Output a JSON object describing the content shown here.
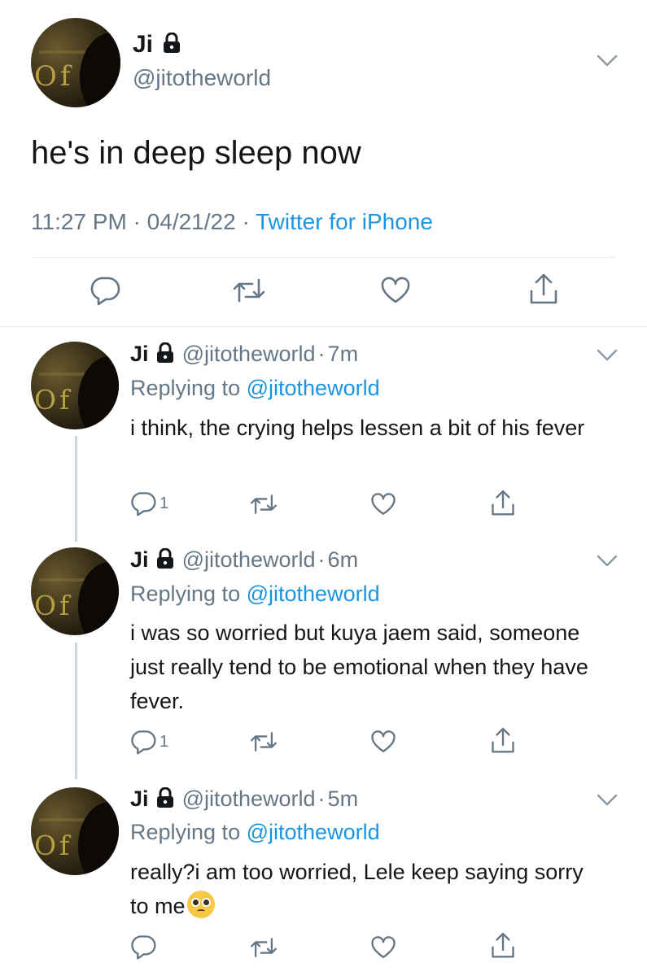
{
  "main_tweet": {
    "display_name": "Ji",
    "handle": "@jitotheworld",
    "text": "he's in deep sleep now",
    "time": "11:27 PM",
    "date": "04/21/22",
    "separator": "·",
    "source": "Twitter for iPhone"
  },
  "avatar_glyph": "Of",
  "replies": [
    {
      "display_name": "Ji",
      "handle": "@jitotheworld",
      "dot": "·",
      "age": "7m",
      "replying_prefix": "Replying to",
      "replying_to": "@jitotheworld",
      "text": "i think, the crying helps lessen a bit of his fever",
      "reply_count": "1"
    },
    {
      "display_name": "Ji",
      "handle": "@jitotheworld",
      "dot": "·",
      "age": "6m",
      "replying_prefix": "Replying to",
      "replying_to": "@jitotheworld",
      "text": "i was so worried but kuya jaem said, someone just really tend to be emotional when they have fever.",
      "reply_count": "1"
    },
    {
      "display_name": "Ji",
      "handle": "@jitotheworld",
      "dot": "·",
      "age": "5m",
      "replying_prefix": "Replying to",
      "replying_to": "@jitotheworld",
      "text": "really?i am too worried, Lele keep saying sorry to me",
      "emoji": "pleading-face",
      "reply_count": ""
    }
  ],
  "icons": [
    "lock-icon",
    "chevron-down-icon",
    "reply-icon",
    "retweet-icon",
    "like-icon",
    "share-icon"
  ],
  "colors": {
    "link": "#1b95e0",
    "secondary": "#657786",
    "icon": "#657786",
    "divider": "#e6ecf0",
    "thread": "#ccd6dd"
  }
}
